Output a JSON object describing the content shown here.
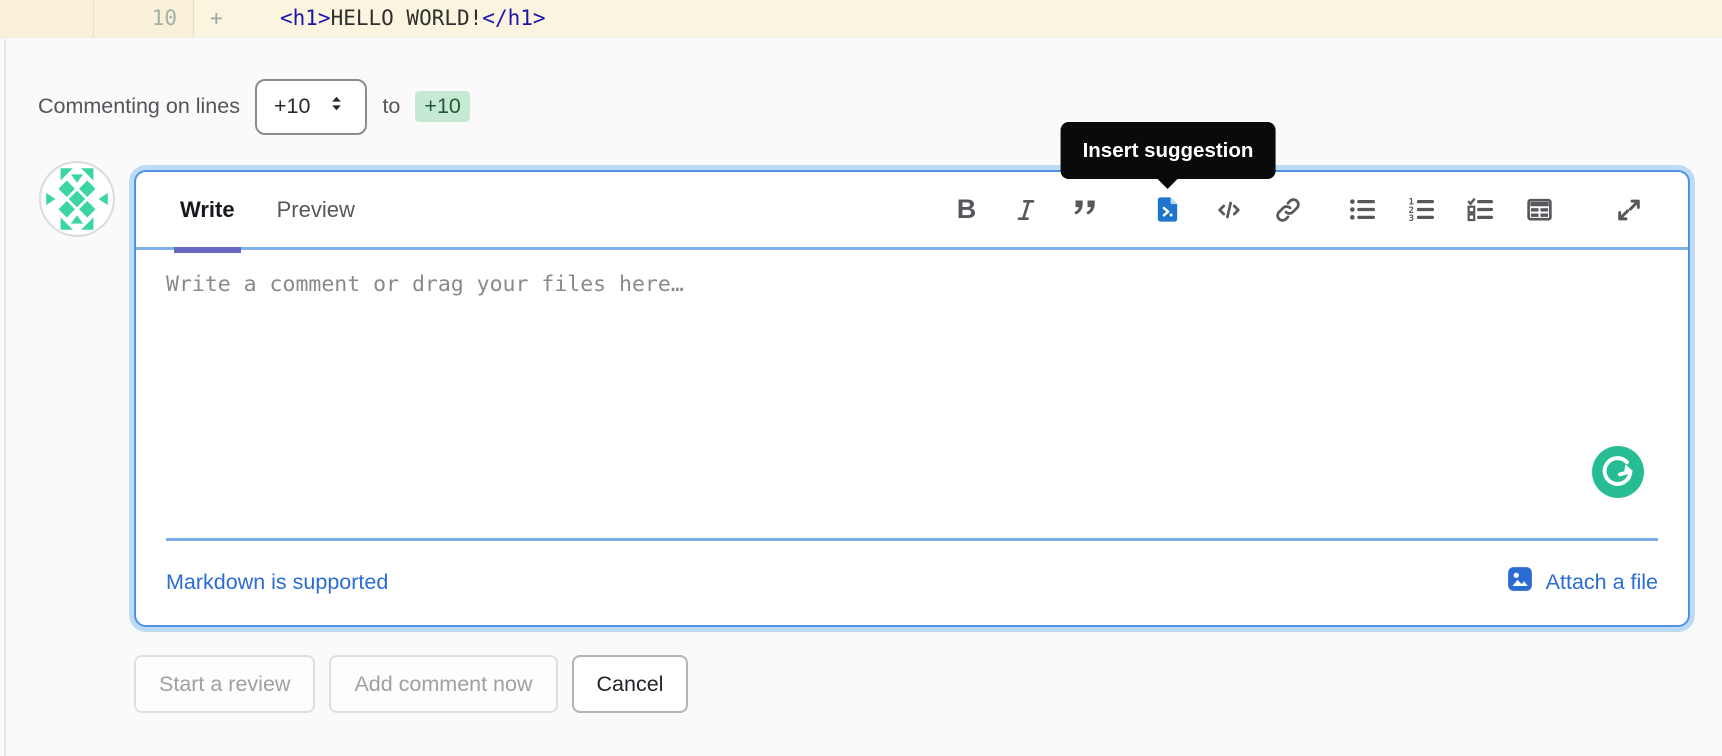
{
  "diff": {
    "new_line_number": "10",
    "sign": "+",
    "code": {
      "open_tag": "<h1>",
      "text": "HELLO WORLD!",
      "close_tag": "</h1>"
    }
  },
  "comment_header": {
    "label": "Commenting on lines",
    "start_line": "+10",
    "to": "to",
    "end_line": "+10"
  },
  "editor": {
    "tabs": {
      "write": "Write",
      "preview": "Preview"
    },
    "tooltip": "Insert suggestion",
    "placeholder": "Write a comment or drag your files here…",
    "markdown_note": "Markdown is supported",
    "attach_label": "Attach a file",
    "toolbar_icons": [
      "bold",
      "italic",
      "quote",
      "insert-suggestion",
      "code",
      "link",
      "bullet-list",
      "numbered-list",
      "task-list",
      "table",
      "full-screen"
    ]
  },
  "actions": {
    "start_review": "Start a review",
    "add_comment": "Add comment now",
    "cancel": "Cancel"
  },
  "colors": {
    "focus_blue": "#4f94e2",
    "link_blue": "#2b6cd4",
    "suggestion_blue": "#1f75cb",
    "badge_green_bg": "#c7e9d3",
    "badge_green_text": "#1e5c37",
    "grammarly_green": "#27bd94",
    "diff_line_bg": "#fbf4df",
    "tab_indicator": "#6767c4",
    "tooltip_bg": "#0a0a0c"
  }
}
